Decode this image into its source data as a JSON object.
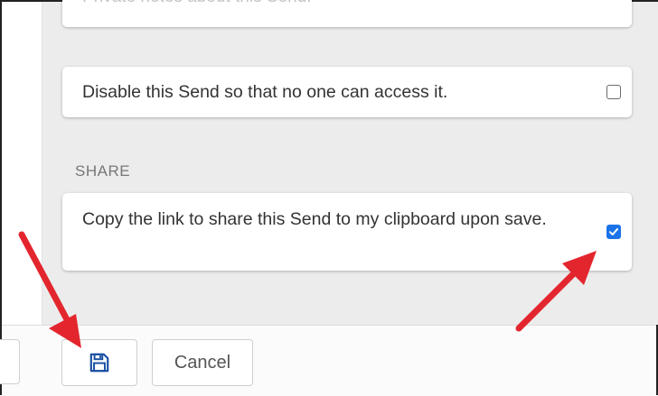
{
  "notes_card": {
    "placeholder": "Private notes about this Send."
  },
  "disable_option": {
    "label": "Disable this Send so that no one can access it.",
    "checked": false
  },
  "share_section": {
    "heading": "SHARE",
    "copy_link_option": {
      "label": "Copy the link to share this Send to my clipboard upon save.",
      "checked": true
    }
  },
  "footer": {
    "save_icon": "floppy-disk-icon",
    "cancel_label": "Cancel"
  },
  "colors": {
    "accent_blue": "#1a73e8",
    "save_icon_blue": "#1a4fa3",
    "annotation_red": "#e3262e",
    "panel_background": "#ececec"
  }
}
